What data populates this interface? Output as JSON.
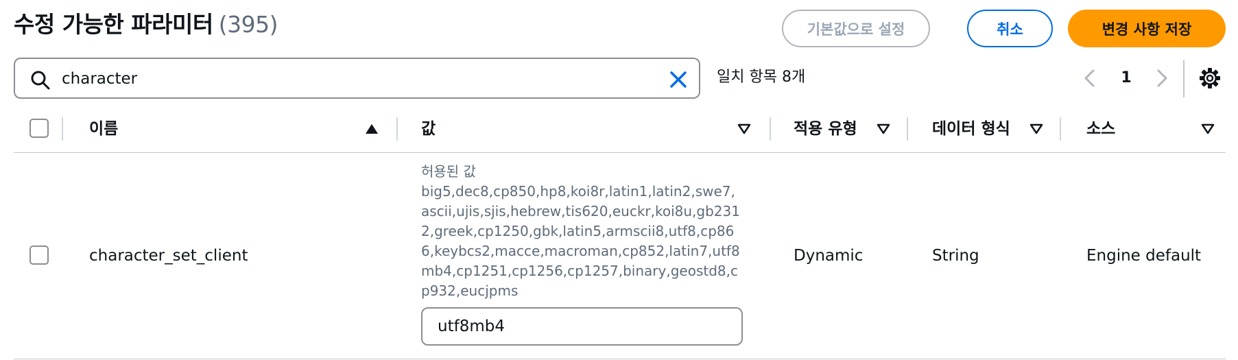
{
  "header": {
    "title": "수정 가능한 파라미터",
    "count": "(395)",
    "reset_button": "기본값으로 설정",
    "cancel_button": "취소",
    "save_button": "변경 사항 저장"
  },
  "search": {
    "value": "character",
    "matches": "일치 항목 8개"
  },
  "pagination": {
    "current_page": "1"
  },
  "table": {
    "columns": [
      "이름",
      "값",
      "적용 유형",
      "데이터 형식",
      "소스"
    ],
    "rows": [
      {
        "name": "character_set_client",
        "allowed_label": "허용된 값",
        "allowed_values": "big5,dec8,cp850,hp8,koi8r,latin1,latin2,swe7,ascii,ujis,sjis,hebrew,tis620,euckr,koi8u,gb2312,greek,cp1250,gbk,latin5,armscii8,utf8,cp866,keybcs2,macce,macroman,cp852,latin7,utf8mb4,cp1251,cp1256,cp1257,binary,geostd8,cp932,eucjpms",
        "value": "utf8mb4",
        "apply_type": "Dynamic",
        "data_type": "String",
        "source": "Engine default"
      }
    ]
  },
  "colors": {
    "primary": "#006ce0",
    "accent": "#ff9900",
    "border": "#8c8c94",
    "muted_text": "#5f6b7a"
  },
  "icons": [
    "search-icon",
    "clear-icon",
    "chevron-left-icon",
    "chevron-right-icon",
    "gear-icon",
    "sort-ascending-icon",
    "sort-icon"
  ]
}
